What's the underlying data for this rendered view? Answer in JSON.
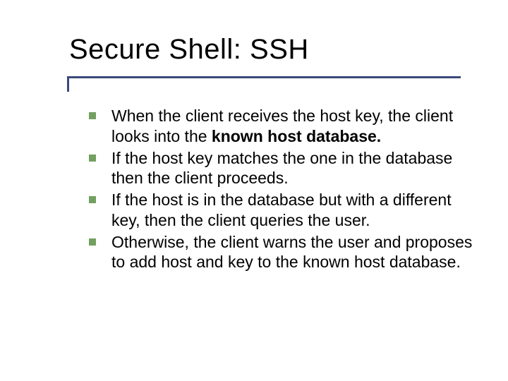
{
  "title": "Secure Shell: SSH",
  "bullets": [
    {
      "pre": "When the client receives the host key, the client looks into the ",
      "bold": "known host database.",
      "post": ""
    },
    {
      "pre": "If the host key matches the one in the database then the client proceeds.",
      "bold": "",
      "post": ""
    },
    {
      "pre": "If the host is in the database but with a different key, then the client queries the user.",
      "bold": "",
      "post": ""
    },
    {
      "pre": "Otherwise, the client warns the user and proposes to add host and key to the known host database.",
      "bold": "",
      "post": ""
    }
  ]
}
